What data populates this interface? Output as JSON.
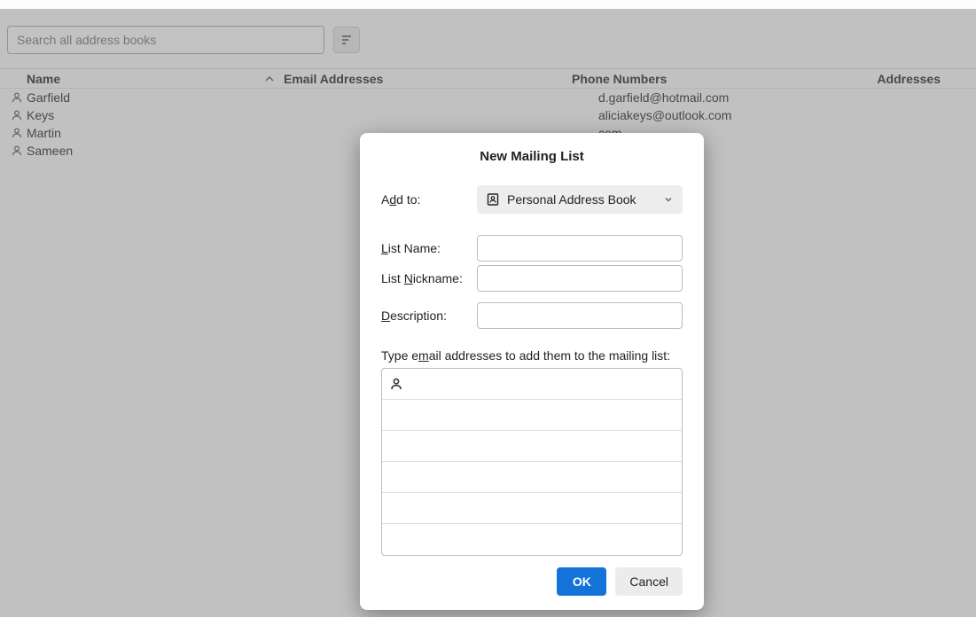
{
  "toolbar": {
    "search_placeholder": "Search all address books"
  },
  "table": {
    "headers": {
      "name": "Name",
      "email": "Email Addresses",
      "phone": "Phone Numbers",
      "addresses": "Addresses"
    },
    "rows": [
      {
        "name": "Garfield",
        "phone": "d.garfield@hotmail.com"
      },
      {
        "name": "Keys",
        "phone": "aliciakeys@outlook.com"
      },
      {
        "name": "Martin",
        "phone": "com"
      },
      {
        "name": "Sameen",
        "phone": ""
      }
    ]
  },
  "dialog": {
    "title": "New Mailing List",
    "add_to_label_pre": "A",
    "add_to_label_u": "d",
    "add_to_label_post": "d to:",
    "add_to_value": "Personal Address Book",
    "list_name_pre": "",
    "list_name_u": "L",
    "list_name_post": "ist Name:",
    "list_nick_pre": "List ",
    "list_nick_u": "N",
    "list_nick_post": "ickname:",
    "desc_pre": "",
    "desc_u": "D",
    "desc_post": "escription:",
    "instruction_pre": "Type e",
    "instruction_u": "m",
    "instruction_post": "ail addresses to add them to the mailing list:",
    "list_name_value": "",
    "list_nick_value": "",
    "desc_value": "",
    "ok_label": "OK",
    "cancel_label": "Cancel"
  }
}
